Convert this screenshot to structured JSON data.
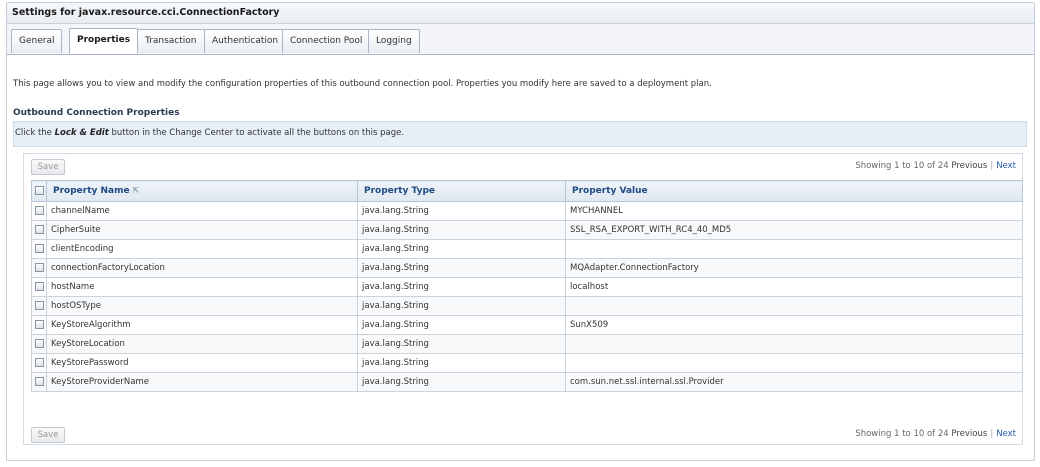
{
  "title": "Settings for javax.resource.cci.ConnectionFactory",
  "tabs": [
    {
      "label": "General"
    },
    {
      "label": "Properties"
    },
    {
      "label": "Transaction"
    },
    {
      "label": "Authentication"
    },
    {
      "label": "Connection Pool"
    },
    {
      "label": "Logging"
    }
  ],
  "active_tab": "Properties",
  "intro_text": "This page allows you to view and modify the configuration properties of this outbound connection pool. Properties you modify here are saved to a deployment plan.",
  "section_title": "Outbound Connection Properties",
  "lock_bar": {
    "prefix": "Click the",
    "emphasis": "Lock & Edit",
    "suffix": "button in the Change Center to activate all the buttons on this page."
  },
  "save_label": "Save",
  "pager": {
    "showing": "Showing 1 to 10 of 24",
    "previous": "Previous",
    "next": "Next"
  },
  "columns": [
    "Property Name",
    "Property Type",
    "Property Value"
  ],
  "sort_icon": "sort-ascending-icon",
  "rows": [
    {
      "name": "channelName",
      "type": "java.lang.String",
      "value": "MYCHANNEL"
    },
    {
      "name": "CipherSuite",
      "type": "java.lang.String",
      "value": "SSL_RSA_EXPORT_WITH_RC4_40_MD5"
    },
    {
      "name": "clientEncoding",
      "type": "java.lang.String",
      "value": ""
    },
    {
      "name": "connectionFactoryLocation",
      "type": "java.lang.String",
      "value": "MQAdapter.ConnectionFactory"
    },
    {
      "name": "hostName",
      "type": "java.lang.String",
      "value": "localhost"
    },
    {
      "name": "hostOSType",
      "type": "java.lang.String",
      "value": ""
    },
    {
      "name": "KeyStoreAlgorithm",
      "type": "java.lang.String",
      "value": "SunX509"
    },
    {
      "name": "KeyStoreLocation",
      "type": "java.lang.String",
      "value": ""
    },
    {
      "name": "KeyStorePassword",
      "type": "java.lang.String",
      "value": ""
    },
    {
      "name": "KeyStoreProviderName",
      "type": "java.lang.String",
      "value": "com.sun.net.ssl.internal.ssl.Provider"
    }
  ],
  "colors": {
    "header_text": "#1d4a84",
    "lock_bar_bg": "#e6eef8",
    "link": "#2559a8"
  }
}
